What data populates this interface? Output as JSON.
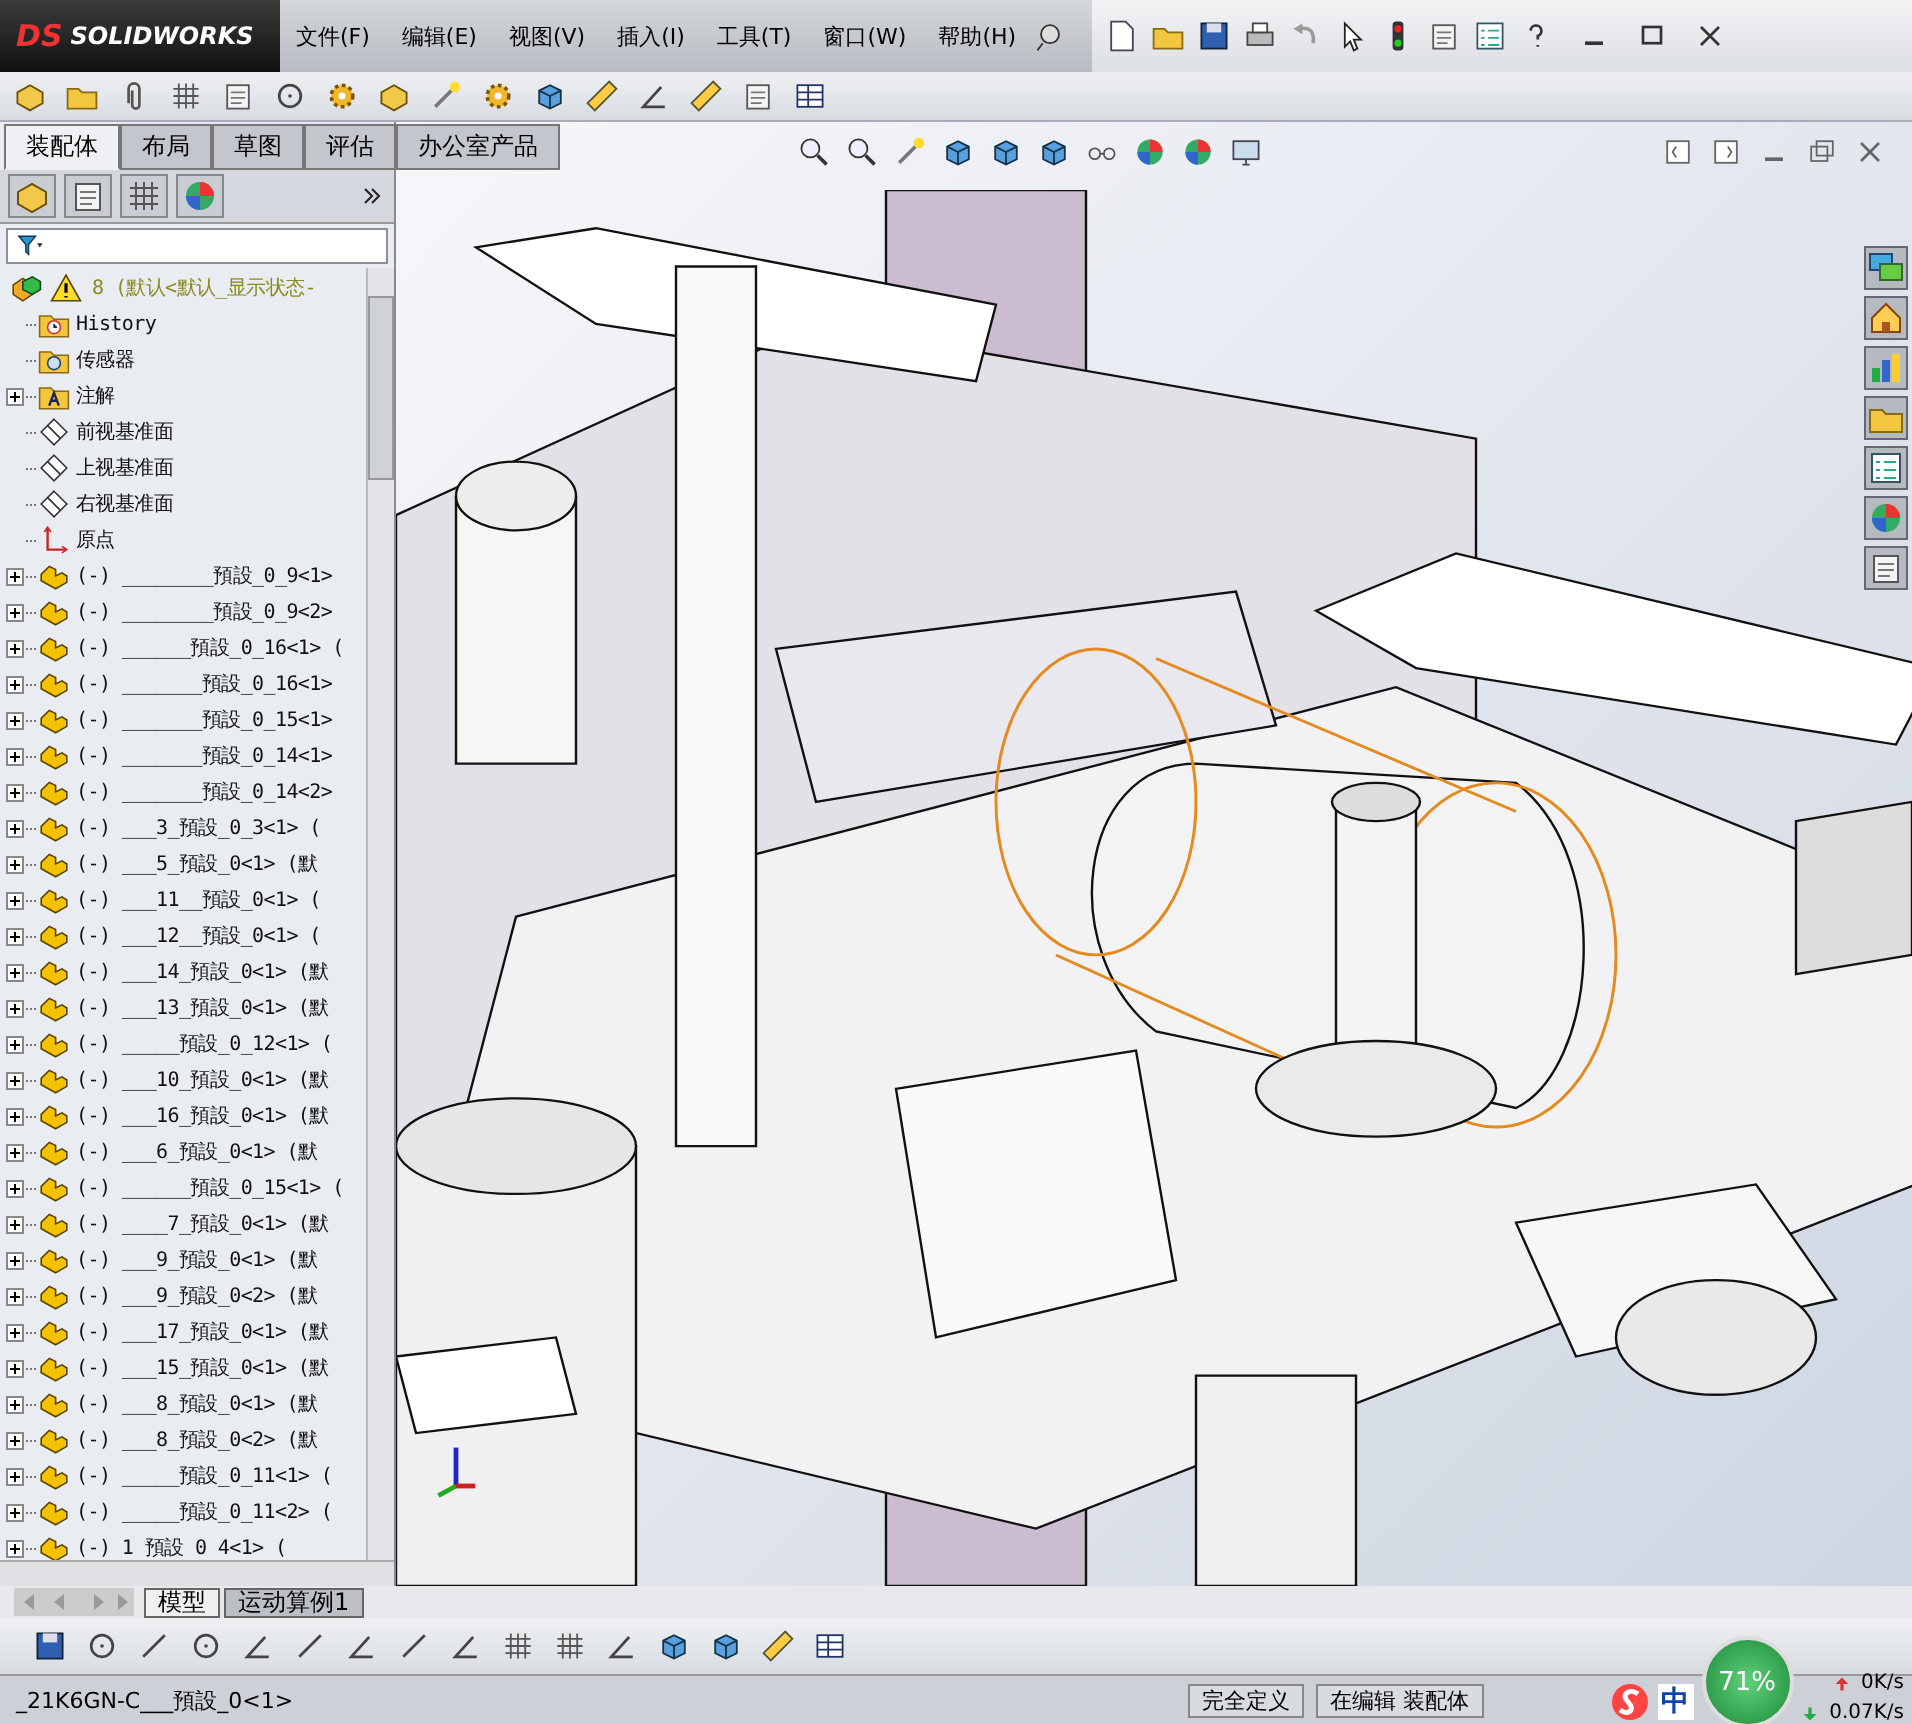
{
  "app": {
    "logo_mark": "DS",
    "logo": "SOLIDWORKS"
  },
  "menu": [
    "文件(F)",
    "编辑(E)",
    "视图(V)",
    "插入(I)",
    "工具(T)",
    "窗口(W)",
    "帮助(H)"
  ],
  "command_tabs": [
    {
      "label": "装配体",
      "selected": true
    },
    {
      "label": "布局",
      "selected": false
    },
    {
      "label": "草图",
      "selected": false
    },
    {
      "label": "评估",
      "selected": false
    },
    {
      "label": "办公室产品",
      "selected": false
    }
  ],
  "feature_tree": {
    "root": "8  (默认<默认_显示状态-",
    "items": [
      {
        "kind": "history",
        "label": "History",
        "collapsed": false
      },
      {
        "kind": "sensor",
        "label": "传感器",
        "collapsed": false
      },
      {
        "kind": "annotation",
        "label": "注解",
        "collapsed": true
      },
      {
        "kind": "plane",
        "label": "前视基准面",
        "collapsed": false
      },
      {
        "kind": "plane",
        "label": "上视基准面",
        "collapsed": false
      },
      {
        "kind": "plane",
        "label": "右视基准面",
        "collapsed": false
      },
      {
        "kind": "origin",
        "label": "原点",
        "collapsed": false
      },
      {
        "kind": "component",
        "label": "(-) ________預設_0_9<1>",
        "collapsed": true
      },
      {
        "kind": "component",
        "label": "(-) ________預設_0_9<2>",
        "collapsed": true
      },
      {
        "kind": "component",
        "label": "(-) ______預設_0_16<1> (",
        "collapsed": true
      },
      {
        "kind": "component",
        "label": "(-) _______預設_0_16<1>",
        "collapsed": true
      },
      {
        "kind": "component",
        "label": "(-) _______預設_0_15<1>",
        "collapsed": true
      },
      {
        "kind": "component",
        "label": "(-) _______預設_0_14<1>",
        "collapsed": true
      },
      {
        "kind": "component",
        "label": "(-) _______預設_0_14<2>",
        "collapsed": true
      },
      {
        "kind": "component",
        "label": "(-) ___3_預設_0_3<1> (",
        "collapsed": true
      },
      {
        "kind": "component",
        "label": "(-) ___5_預設_0<1> (默",
        "collapsed": true
      },
      {
        "kind": "component",
        "label": "(-) ___11__預設_0<1> (",
        "collapsed": true
      },
      {
        "kind": "component",
        "label": "(-) ___12__預設_0<1> (",
        "collapsed": true
      },
      {
        "kind": "component",
        "label": "(-) ___14_預設_0<1> (默",
        "collapsed": true
      },
      {
        "kind": "component",
        "label": "(-) ___13_預設_0<1> (默",
        "collapsed": true
      },
      {
        "kind": "component",
        "label": "(-) _____預設_0_12<1> (",
        "collapsed": true
      },
      {
        "kind": "component",
        "label": "(-) ___10_預設_0<1> (默",
        "collapsed": true
      },
      {
        "kind": "component",
        "label": "(-) ___16_預設_0<1> (默",
        "collapsed": true
      },
      {
        "kind": "component",
        "label": "(-) ___6_預設_0<1> (默",
        "collapsed": true
      },
      {
        "kind": "component",
        "label": "(-) ______預設_0_15<1> (",
        "collapsed": true
      },
      {
        "kind": "component",
        "label": "(-) ____7_預設_0<1> (默",
        "collapsed": true
      },
      {
        "kind": "component",
        "label": "(-) ___9_預設_0<1> (默",
        "collapsed": true
      },
      {
        "kind": "component",
        "label": "(-) ___9_預設_0<2> (默",
        "collapsed": true
      },
      {
        "kind": "component",
        "label": "(-) ___17_預設_0<1> (默",
        "collapsed": true
      },
      {
        "kind": "component",
        "label": "(-) ___15_預設_0<1> (默",
        "collapsed": true
      },
      {
        "kind": "component",
        "label": "(-) ___8_預設_0<1> (默",
        "collapsed": true
      },
      {
        "kind": "component",
        "label": "(-) ___8_預設_0<2> (默",
        "collapsed": true
      },
      {
        "kind": "component",
        "label": "(-) _____預設_0_11<1> (",
        "collapsed": true
      },
      {
        "kind": "component",
        "label": "(-) _____預設_0_11<2> (",
        "collapsed": true
      },
      {
        "kind": "component",
        "label": "(-)   1 預設 0 4<1> (",
        "collapsed": true
      }
    ]
  },
  "bottom_tabs": [
    {
      "label": "模型",
      "selected": true
    },
    {
      "label": "运动算例1",
      "selected": false
    }
  ],
  "status_bar": {
    "document": "_21K6GN-C___預設_0<1>",
    "fields": [
      "完全定义",
      "在编辑 装配体"
    ]
  },
  "tray": {
    "ime": "中",
    "meter": "71%",
    "upload": "0K/s",
    "download": "0.07K/s"
  }
}
